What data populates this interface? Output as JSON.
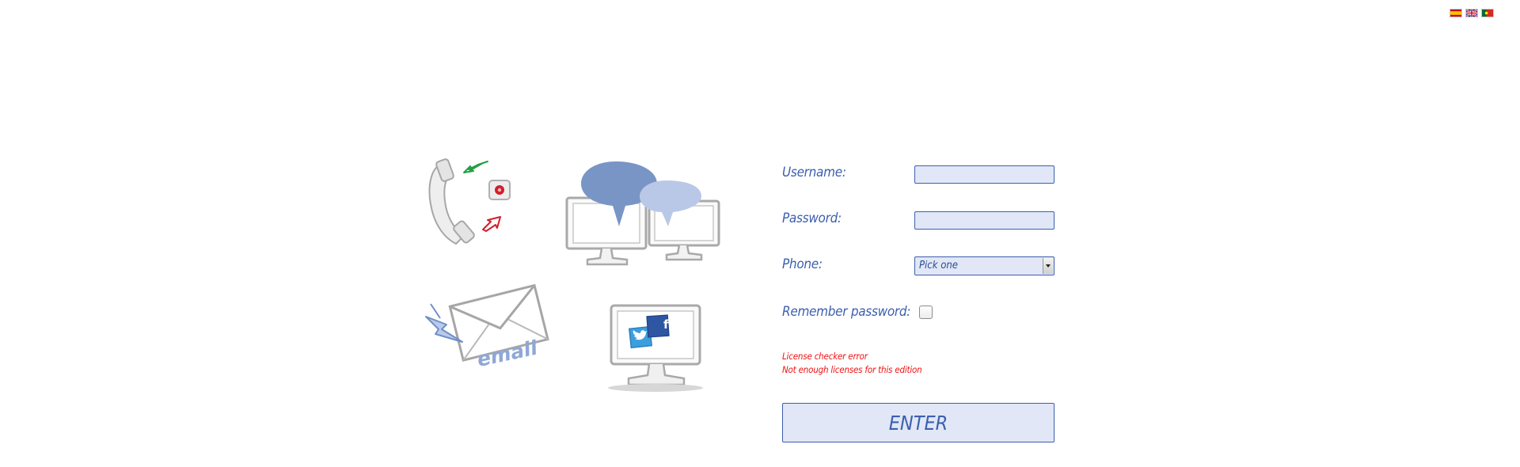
{
  "languages": [
    {
      "name": "Español",
      "icon": "spain-flag-icon"
    },
    {
      "name": "English",
      "icon": "uk-flag-icon"
    },
    {
      "name": "Português",
      "icon": "portugal-flag-icon"
    }
  ],
  "illustrations": {
    "phone": {
      "icon": "telephone-calls-icon"
    },
    "chat": {
      "icon": "chat-monitors-icon"
    },
    "email": {
      "icon": "email-envelope-icon",
      "text": "email"
    },
    "social": {
      "icon": "social-media-monitor-icon",
      "facebook_glyph": "f"
    }
  },
  "form": {
    "username_label": "Username:",
    "username_value": "",
    "password_label": "Password:",
    "password_value": "",
    "phone_label": "Phone:",
    "phone_selected": "Pick one",
    "remember_label": "Remember password:",
    "remember_checked": false,
    "error_line1": "License checker error",
    "error_line2": "Not enough licenses for this edition",
    "enter_label": "ENTER"
  },
  "colors": {
    "accent": "#3c5fae",
    "field_bg": "#e1e7f6",
    "error": "#ee1111"
  }
}
